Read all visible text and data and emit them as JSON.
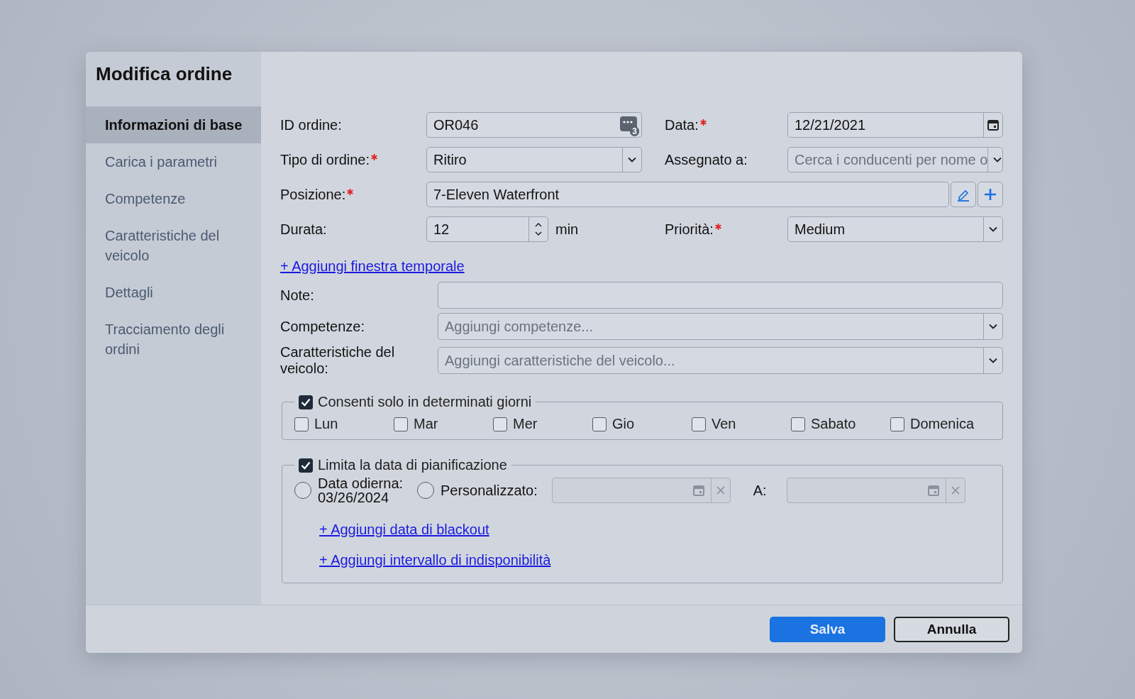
{
  "dialog": {
    "title": "Modifica ordine"
  },
  "sidebar": {
    "items": [
      {
        "label": "Informazioni di base",
        "selected": true
      },
      {
        "label": "Carica i parametri",
        "selected": false
      },
      {
        "label": "Competenze",
        "selected": false
      },
      {
        "label": "Caratteristiche del veicolo",
        "selected": false
      },
      {
        "label": "Dettagli",
        "selected": false
      },
      {
        "label": "Tracciamento degli ordini",
        "selected": false
      }
    ]
  },
  "fields": [
    {
      "kind": "id",
      "label": "ID ordine:",
      "required": false,
      "value": "OR046",
      "badge": "3"
    },
    {
      "kind": "date",
      "label": "Data:",
      "required": true,
      "value": "12/21/2021"
    },
    {
      "kind": "select",
      "label": "Tipo di ordine:",
      "required": true,
      "value": "Ritiro"
    },
    {
      "kind": "select",
      "label": "Assegnato a:",
      "required": false,
      "placeholder": "Cerca i conducenti per nome o"
    },
    {
      "kind": "location",
      "label": "Posizione:",
      "required": true,
      "value": "7-Eleven Waterfront"
    },
    {
      "kind": "stepper",
      "label": "Durata:",
      "required": false,
      "value": "12",
      "unit": "min"
    },
    {
      "kind": "select",
      "label": "Priorità:",
      "required": true,
      "value": "Medium"
    }
  ],
  "time_window_link": "+ Aggiungi finestra temporale",
  "extra_fields": [
    {
      "kind": "text",
      "label": "Note:"
    },
    {
      "kind": "select",
      "label": "Competenze:",
      "placeholder": "Aggiungi competenze..."
    },
    {
      "kind": "select",
      "label": "Caratteristiche del veicolo:",
      "placeholder": "Aggiungi caratteristiche del veicolo..."
    }
  ],
  "days_section": {
    "label": "Consenti solo in determinati giorni",
    "checked": true,
    "days": [
      {
        "label": "Lun",
        "checked": false
      },
      {
        "label": "Mar",
        "checked": false
      },
      {
        "label": "Mer",
        "checked": false
      },
      {
        "label": "Gio",
        "checked": false
      },
      {
        "label": "Ven",
        "checked": false
      },
      {
        "label": "Sabato",
        "checked": false
      },
      {
        "label": "Domenica",
        "checked": false
      }
    ]
  },
  "date_section": {
    "label": "Limita la data di pianificazione",
    "checked": true,
    "options": [
      {
        "label": "Data odierna: 03/26/2024",
        "selected": false
      },
      {
        "label": "Personalizzato:",
        "selected": false
      }
    ],
    "to_label": "A:",
    "links": [
      "+ Aggiungi data di blackout",
      "+ Aggiungi intervallo di indisponibilità"
    ]
  },
  "buttons": [
    {
      "kind": "primary",
      "label": "Salva"
    },
    {
      "kind": "secondary",
      "label": "Annulla"
    }
  ]
}
